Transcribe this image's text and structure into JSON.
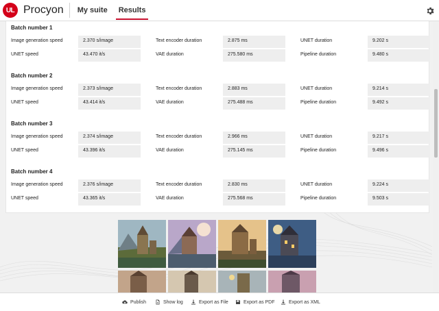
{
  "app": {
    "title": "Procyon",
    "logo_text": "UL"
  },
  "tabs": [
    {
      "label": "My suite",
      "active": false
    },
    {
      "label": "Results",
      "active": true
    }
  ],
  "labels": {
    "image_generation_speed": "Image generation speed",
    "unet_speed": "UNET speed",
    "text_encoder_duration": "Text encoder duration",
    "vae_duration": "VAE duration",
    "unet_duration": "UNET duration",
    "pipeline_duration": "Pipeline duration"
  },
  "batches": [
    {
      "title": "Batch number 1",
      "image_generation_speed": "2.370 s/image",
      "unet_speed": "43.470 it/s",
      "text_encoder_duration": "2.875 ms",
      "vae_duration": "275.580 ms",
      "unet_duration": "9.202 s",
      "pipeline_duration": "9.480 s"
    },
    {
      "title": "Batch number 2",
      "image_generation_speed": "2.373 s/image",
      "unet_speed": "43.414 it/s",
      "text_encoder_duration": "2.883 ms",
      "vae_duration": "275.488 ms",
      "unet_duration": "9.214 s",
      "pipeline_duration": "9.492 s"
    },
    {
      "title": "Batch number 3",
      "image_generation_speed": "2.374 s/image",
      "unet_speed": "43.396 it/s",
      "text_encoder_duration": "2.966 ms",
      "vae_duration": "275.145 ms",
      "unet_duration": "9.217 s",
      "pipeline_duration": "9.496 s"
    },
    {
      "title": "Batch number 4",
      "image_generation_speed": "2.376 s/image",
      "unet_speed": "43.365 it/s",
      "text_encoder_duration": "2.830 ms",
      "vae_duration": "275.568 ms",
      "unet_duration": "9.224 s",
      "pipeline_duration": "9.503 s"
    }
  ],
  "footer": {
    "publish": "Publish",
    "show_log": "Show log",
    "export_file": "Export as File",
    "export_pdf": "Export as PDF",
    "export_xml": "Export as XML"
  },
  "icons": {
    "settings": "gear-icon",
    "publish": "cloud-upload-icon",
    "show_log": "document-icon",
    "export_file": "download-icon",
    "export_pdf": "save-icon",
    "export_xml": "download-icon"
  },
  "colors": {
    "accent": "#c8102e",
    "logo": "#d4001a"
  }
}
